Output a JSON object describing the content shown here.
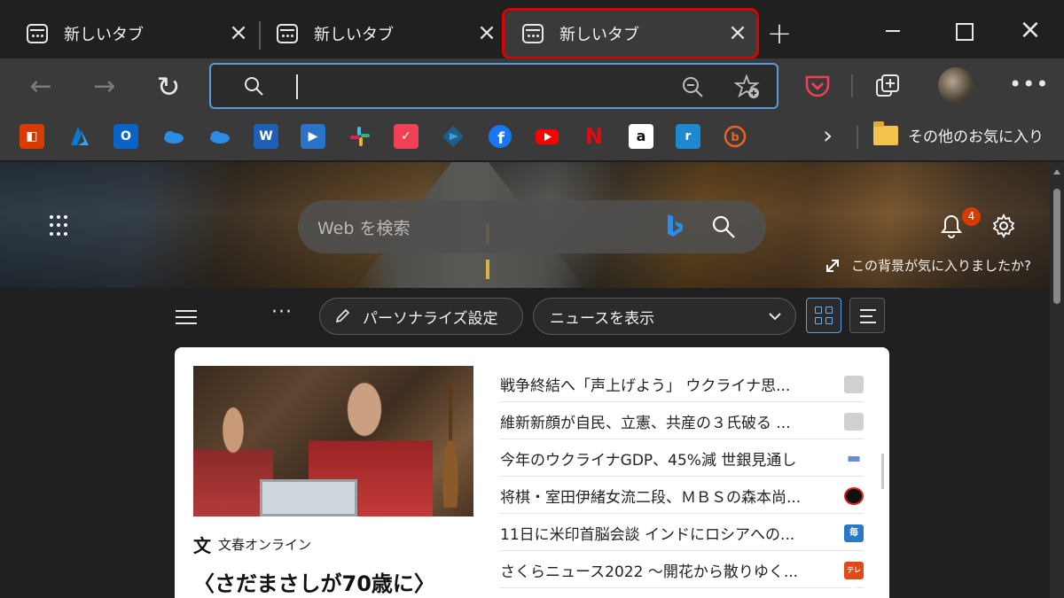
{
  "tabs": [
    {
      "title": "新しいタブ"
    },
    {
      "title": "新しいタブ"
    },
    {
      "title": "新しいタブ"
    }
  ],
  "address_bar": {
    "value": ""
  },
  "favorites": {
    "items": [
      "office-icon",
      "azure-icon",
      "outlook-icon",
      "onedrive-icon",
      "onedrive-icon",
      "word-icon",
      "stream-icon",
      "slack-icon",
      "pocket-icon",
      "remote-icon",
      "facebook-icon",
      "youtube-icon",
      "netflix-icon",
      "amazon-icon",
      "radiko-icon",
      "bitly-icon"
    ],
    "other_label": "その他のお気に入り"
  },
  "hero": {
    "search_placeholder": "Web を検索",
    "notification_count": "4",
    "bg_question": "この背景が気に入りましたか?"
  },
  "feed": {
    "personalize_label": "パーソナライズ設定",
    "news_select": "ニュースを表示"
  },
  "card": {
    "source": "文春オンライン",
    "source_logo": "文",
    "headline": "〈さだまさしが70歳に〉"
  },
  "headlines": [
    {
      "text": "戦争終結へ「声上げよう」 ウクライナ思...",
      "logo_color": "#bdbdbd"
    },
    {
      "text": "維新新顔が自民、立憲、共産の３氏破る ...",
      "logo_color": "#bdbdbd"
    },
    {
      "text": "今年のウクライナGDP、45%減 世銀見通し",
      "logo_color": "#6a8bd0"
    },
    {
      "text": "将棋・室田伊緒女流二段、ＭＢＳの森本尚...",
      "logo_color": "#111111"
    },
    {
      "text": "11日に米印首脳会談 インドにロシアへの...",
      "logo_color": "#2a78c8",
      "logo_text": "毎"
    },
    {
      "text": "さくらニュース2022 ～開花から散りゆく...",
      "logo_color": "#e04a1a",
      "logo_text": "テレ朝"
    }
  ],
  "colors": {
    "accent": "#5a9ad9",
    "tab_highlight": "#e00000",
    "badge": "#d83b01"
  }
}
